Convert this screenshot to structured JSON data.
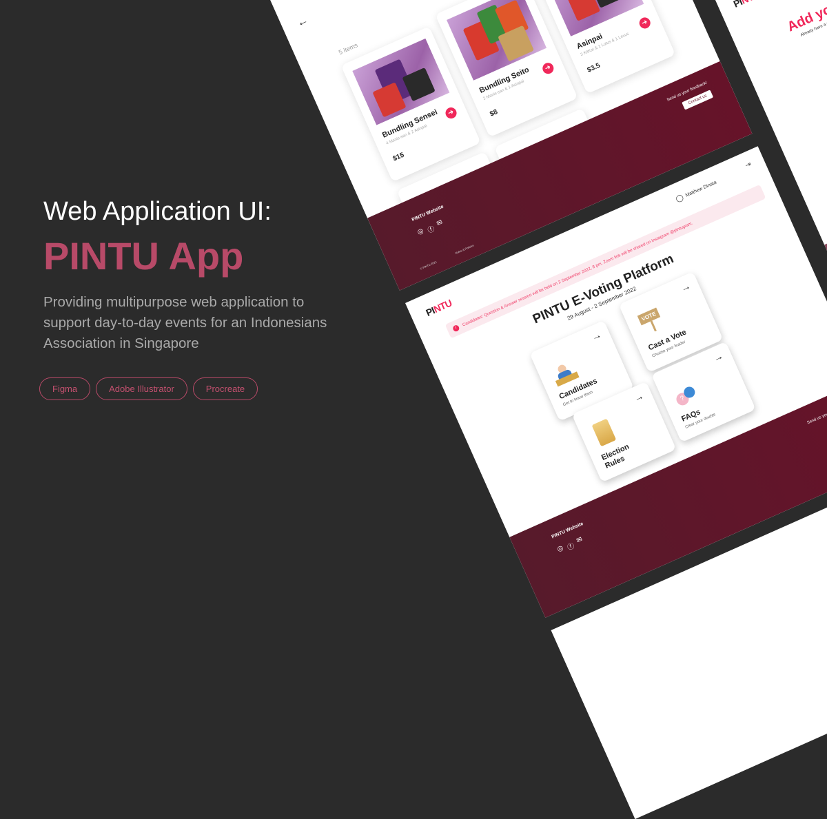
{
  "intro": {
    "heading": "Web Application UI:",
    "title": "PINTU App",
    "description": "Providing multipurpose web application to support day-to-day events for an Indonesians Association in Singapore",
    "tools": [
      "Figma",
      "Adobe Illustrator",
      "Procreate"
    ]
  },
  "colors": {
    "background": "#2b2b2b",
    "accent": "#b84a68",
    "maroon": "#5e1528",
    "brand_red": "#f0285a"
  },
  "logo": {
    "part1": "PI",
    "part2": "NTU"
  },
  "shop": {
    "back_icon": "arrow-left-icon",
    "count": "5 items",
    "items": [
      {
        "name": "Bundling Sensei",
        "desc": "4 Manis-san & 2 Asinpai",
        "price": "$15"
      },
      {
        "name": "Bundling Seito",
        "desc": "2 Manis-san & 1 Asinpai",
        "price": "$8"
      },
      {
        "name": "Asinpai",
        "desc": "3 KitKat & 1 Lotus & 1 Lexus",
        "price": "$3.5"
      }
    ],
    "footer": {
      "site": "PINTU Website",
      "copyright": "© PINTU 2021",
      "rules": "Rules & Policies",
      "feedback": "Send us your feedback!",
      "contact": "Contact us"
    }
  },
  "voting": {
    "user": "Matthew Dinata",
    "alert": "Candidates' Question & Answer session will be held on 2 September 2022, 8 pm. Zoom link will be shared on Instagram @pintugram.",
    "title": "PINTU E-Voting Platform",
    "dates": "29 August - 2 September 2022",
    "cards": [
      {
        "title": "Candidates",
        "sub": "Get to know them"
      },
      {
        "title": "Cast a Vote",
        "sub": "Choose your leader",
        "badge": "VOTE"
      },
      {
        "title": "Election Rules",
        "sub": ""
      },
      {
        "title": "FAQs",
        "sub": "Clear your doubts"
      }
    ],
    "footer": {
      "site": "PINTU Website",
      "feedback": "Send us your"
    }
  },
  "addshop": {
    "title": "Add your",
    "sub": "Already have a shop?"
  }
}
